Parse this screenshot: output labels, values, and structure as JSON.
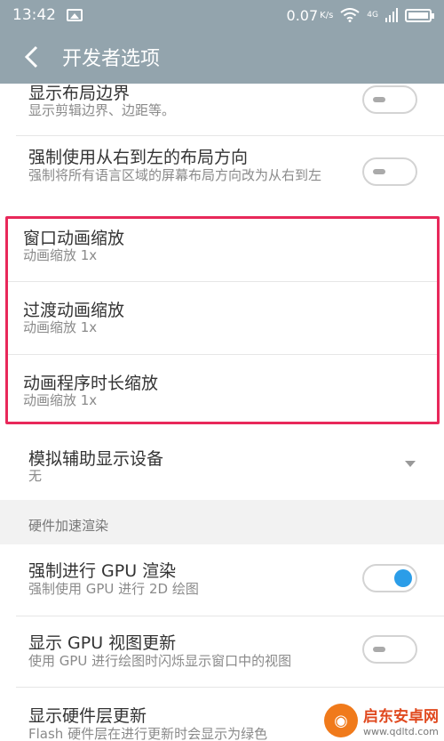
{
  "status_bar": {
    "time": "13:42",
    "speed": "0.07",
    "speed_unit": "K/s",
    "network": "4G"
  },
  "app_bar": {
    "title": "开发者选项"
  },
  "settings": [
    {
      "title": "显示布局边界",
      "subtitle": "显示剪辑边界、边距等。",
      "toggle": "off"
    },
    {
      "title": "强制使用从右到左的布局方向",
      "subtitle": "强制将所有语言区域的屏幕布局方向改为从右到左",
      "toggle": "off"
    },
    {
      "title": "窗口动画缩放",
      "subtitle": "动画缩放 1x"
    },
    {
      "title": "过渡动画缩放",
      "subtitle": "动画缩放 1x"
    },
    {
      "title": "动画程序时长缩放",
      "subtitle": "动画缩放 1x"
    },
    {
      "title": "模拟辅助显示设备",
      "subtitle": "无"
    }
  ],
  "section_header": "硬件加速渲染",
  "hardware_settings": [
    {
      "title": "强制进行 GPU 渲染",
      "subtitle": "强制使用 GPU 进行 2D 绘图",
      "toggle": "on"
    },
    {
      "title": "显示 GPU 视图更新",
      "subtitle": "使用 GPU 进行绘图时闪烁显示窗口中的视图",
      "toggle": "off"
    },
    {
      "title": "显示硬件层更新",
      "subtitle": "Flash 硬件层在进行更新时会显示为绿色"
    }
  ],
  "watermark": {
    "name": "启东安卓网",
    "url": "www.qdltd.com"
  },
  "colors": {
    "bar": "#93a4ad",
    "highlight": "#e8285a",
    "toggle_on": "#2b9de8"
  }
}
